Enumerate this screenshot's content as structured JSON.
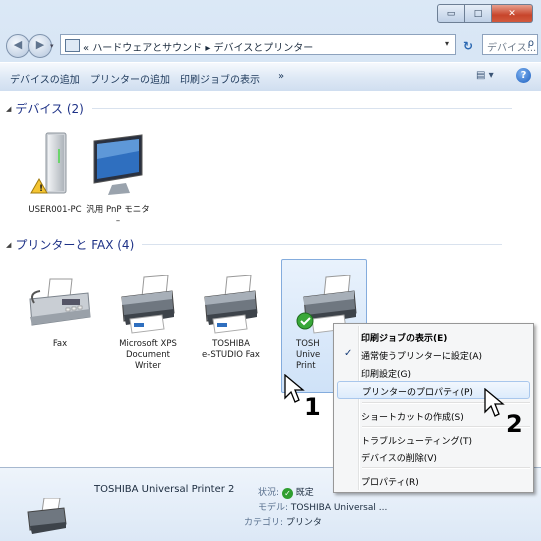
{
  "window": {
    "caption_buttons": [
      "minimize-icon",
      "maximize-icon",
      "close-icon"
    ],
    "caption_glyphs": {
      "minimize": "▭",
      "maximize": "□",
      "close": "✕"
    }
  },
  "nav": {
    "back_glyph": "◀",
    "forward_glyph": "▶",
    "address_prefix": "«",
    "breadcrumb_1": "ハードウェアとサウンド",
    "breadcrumb_sep": "▸",
    "breadcrumb_2": "デバイスとプリンター",
    "dropdown_glyph": "▾",
    "refresh_glyph": "↻",
    "search_placeholder": "デバイス...",
    "search_glyph": "ρ"
  },
  "commandbar": {
    "items": [
      "デバイスの追加",
      "プリンターの追加",
      "印刷ジョブの表示",
      "»"
    ],
    "view_glyph": "▤ ▾",
    "help_glyph": "?"
  },
  "groups": {
    "devices": {
      "title": "デバイス (2)",
      "items": [
        "USER001-PC",
        "汎用 PnP モニタ\n–"
      ]
    },
    "printers": {
      "title": "プリンターと FAX (4)",
      "items": [
        "Fax",
        "Microsoft XPS\nDocument\nWriter",
        "TOSHIBA\ne-STUDIO Fax",
        "TOSH\nUnive\nPrint"
      ]
    }
  },
  "context_menu": {
    "items": [
      {
        "label": "印刷ジョブの表示(E)",
        "bold": true
      },
      {
        "label": "通常使うプリンターに設定(A)",
        "checked": true
      },
      {
        "label": "印刷設定(G)"
      },
      {
        "label": "プリンターのプロパティ(P)",
        "highlighted": true
      },
      {
        "label": "ショートカットの作成(S)"
      },
      {
        "label": "トラブルシューティング(T)"
      },
      {
        "label": "デバイスの削除(V)"
      },
      {
        "label": "プロパティ(R)"
      }
    ],
    "check_glyph": "✓"
  },
  "status_pane": {
    "name": "TOSHIBA Universal Printer 2",
    "state_label": "状況:",
    "state_value": "既定",
    "model_label": "モデル:",
    "model_value": "TOSHIBA Universal ...",
    "category_label": "カテゴリ:",
    "category_value": "プリンタ"
  },
  "callouts": {
    "one": "1",
    "two": "2"
  },
  "colors": {
    "accent": "#1e3287",
    "selection": "#cfe2f8",
    "default_badge": "#2f9e2f"
  }
}
